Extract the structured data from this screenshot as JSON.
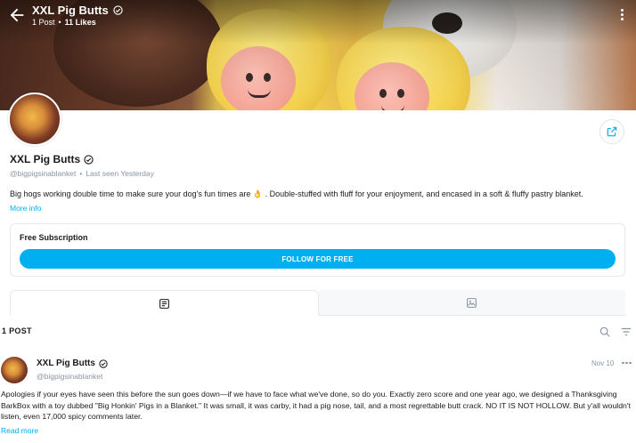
{
  "header": {
    "title": "XXL Pig Butts",
    "post_count": "1 Post",
    "separator": "•",
    "likes": "11 Likes"
  },
  "profile": {
    "name": "XXL Pig Butts",
    "handle": "@bigpigsinablanket",
    "separator": "•",
    "last_seen": "Last seen Yesterday",
    "bio": "Big hogs working double time to make sure your dog's fun times are 👌 . Double-stuffed with fluff for your enjoyment, and encased in a soft & fluffy pastry blanket.",
    "more_info": "More info"
  },
  "subscription": {
    "title": "Free Subscription",
    "button_label": "FOLLOW FOR FREE"
  },
  "tabs": [
    {
      "icon": "posts-icon",
      "active": true
    },
    {
      "icon": "media-icon",
      "active": false
    }
  ],
  "posts_bar": {
    "count_label": "1 POST"
  },
  "post": {
    "author": "XXL Pig Butts",
    "handle": "@bigpigsinablanket",
    "date": "Nov 10",
    "body": "Apologies if your eyes have seen this before the sun goes down—if we have to face what we've done, so do you. Exactly zero score and one year ago, we designed a Thanksgiving BarkBox with a toy dubbed \"Big Honkin' Pigs in a Blanket.\" It was small, it was carby, it had a pig nose, tail, and a most regrettable butt crack. NO IT IS NOT HOLLOW. But y'all wouldn't listen, even 17,000 spicy comments later.",
    "read_more": "Read more"
  },
  "colors": {
    "accent": "#00aff0",
    "muted_text": "#8a96a3",
    "border": "#e6e9ec"
  }
}
